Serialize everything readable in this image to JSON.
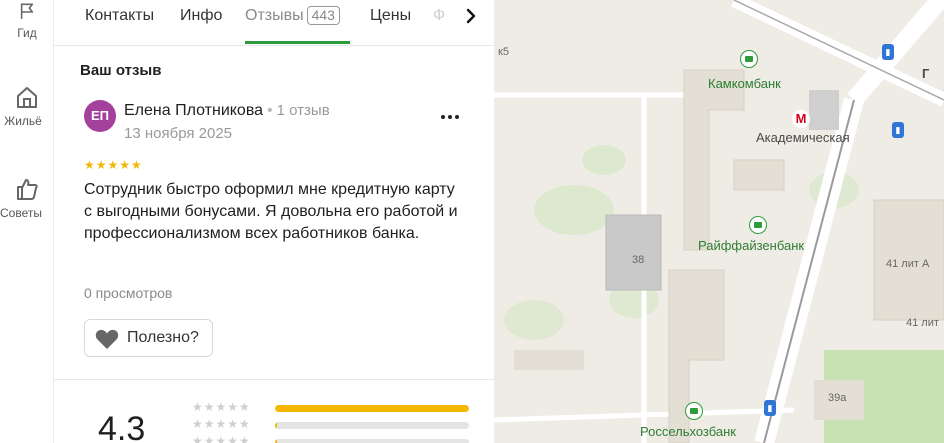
{
  "rail": {
    "items": [
      {
        "label": "Гид",
        "icon": "flag-icon"
      },
      {
        "label": "Жильё",
        "icon": "house-icon"
      },
      {
        "label": "Советы",
        "icon": "thumbs-up-icon"
      }
    ]
  },
  "tabs": {
    "items": [
      {
        "label": "Контакты"
      },
      {
        "label": "Инфо"
      },
      {
        "label": "Отзывы",
        "count": "443",
        "active": true
      },
      {
        "label": "Цены"
      },
      {
        "label": "Ф"
      }
    ]
  },
  "review_section": {
    "title": "Ваш отзыв"
  },
  "review": {
    "avatar_initials": "ЕП",
    "author": "Елена Плотникова",
    "separator": "•",
    "reviews_count": "1 отзыв",
    "date": "13 ноября 2025",
    "stars": "★★★★★",
    "rating": 5,
    "text": "Сотрудник быстро оформил мне кредитную карту с выгодными бонусами. Я довольна его работой и профессионализмом всех работников банка.",
    "views": "0 просмотров",
    "useful_label": "Полезно?"
  },
  "summary": {
    "rating": "4.3",
    "distribution": [
      {
        "stars": "★★★★★",
        "fraction": 1.0
      },
      {
        "stars": "★★★★★",
        "fraction": 0.01
      },
      {
        "stars": "★★★★★",
        "fraction": 0.01
      }
    ]
  },
  "map": {
    "labels": {
      "kamkombank": "Камкомбанк",
      "akademicheskaya": "Академическая",
      "raiffeisen": "Райффайзенбанк",
      "rosselkhoz": "Россельхозбанк",
      "b38": "38",
      "b41a": "41 лит А",
      "b41b": "41 лит",
      "b39a": "39а",
      "k5": "к5",
      "edge_g": "Г"
    }
  },
  "colors": {
    "accent_green": "#2e9b3a",
    "star_yellow": "#f2b705",
    "avatar": "#a4419d",
    "metro_red": "#d6001c",
    "bus_blue": "#2f76d6"
  }
}
